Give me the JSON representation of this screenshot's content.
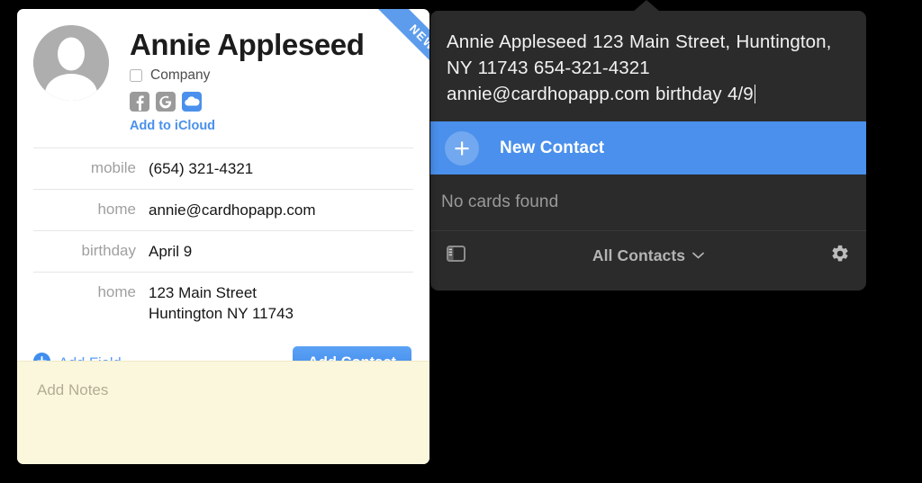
{
  "colors": {
    "accent_blue": "#4a90ec",
    "ribbon_blue": "#5d9cec",
    "panel_dark": "#2b2b2b",
    "notes_cream": "#fbf7dd",
    "card_white": "#ffffff",
    "label_gray": "#a0a0a0"
  },
  "search_panel": {
    "input_value": "Annie Appleseed 123 Main Street, Huntington, NY 11743 654-321-4321 annie@cardhopapp.com birthday 4/9",
    "new_contact_label": "New Contact",
    "new_contact_icon": "plus-icon",
    "no_results_label": "No cards found",
    "toolbar": {
      "sidebar_toggle_icon": "sidebar-toggle-icon",
      "group_label": "All Contacts",
      "group_chevron_icon": "chevron-down-icon",
      "settings_icon": "gear-icon"
    }
  },
  "contact_card": {
    "ribbon_label": "NEW",
    "avatar_icon": "person-placeholder-avatar",
    "name": "Annie Appleseed",
    "company_checkbox_label": "Company",
    "company_checked": false,
    "service_icons": [
      {
        "name": "facebook-icon",
        "glyph": "f",
        "enabled": false
      },
      {
        "name": "google-icon",
        "glyph": "G",
        "enabled": false
      },
      {
        "name": "icloud-icon",
        "glyph": "cloud",
        "enabled": true
      }
    ],
    "add_to_icloud_label": "Add to iCloud",
    "fields": [
      {
        "label": "mobile",
        "value": "(654) 321-4321"
      },
      {
        "label": "home",
        "value": "annie@cardhopapp.com"
      },
      {
        "label": "birthday",
        "value": "April 9"
      },
      {
        "label": "home",
        "value": "123 Main Street\nHuntington  NY  11743"
      }
    ],
    "add_field_label": "Add Field",
    "add_field_icon": "plus-circle-icon",
    "add_contact_button": "Add Contact",
    "notes_placeholder": "Add Notes"
  }
}
